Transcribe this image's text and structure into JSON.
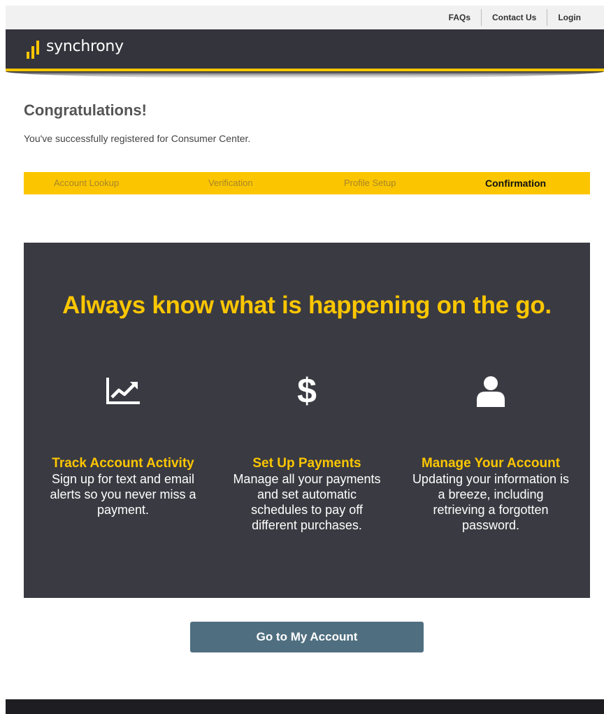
{
  "topnav": {
    "faqs": "FAQs",
    "contact": "Contact Us",
    "login": "Login"
  },
  "brand": {
    "name": "synchrony",
    "accent": "#fbc600",
    "dark": "#34343c"
  },
  "congrats": {
    "title": "Congratulations!",
    "subtitle": "You've successfully registered for Consumer Center."
  },
  "steps": [
    {
      "label": "Account Lookup"
    },
    {
      "label": "Verification"
    },
    {
      "label": "Profile Setup"
    },
    {
      "label": "Confirmation",
      "active": true
    }
  ],
  "promo": {
    "headline": "Always know what is happening on the go.",
    "features": [
      {
        "icon": "chart-icon",
        "title": "Track Account Activity",
        "desc": "Sign up for text and email alerts so you never miss a payment."
      },
      {
        "icon": "dollar-icon",
        "title": "Set Up Payments",
        "desc": "Manage all your payments and set automatic schedules to pay off different purchases.",
        "glyph": "$"
      },
      {
        "icon": "user-icon",
        "title": "Manage Your Account",
        "desc": "Updating your information is a breeze, including retrieving a forgotten password."
      }
    ]
  },
  "cta": {
    "label": "Go to My Account"
  }
}
